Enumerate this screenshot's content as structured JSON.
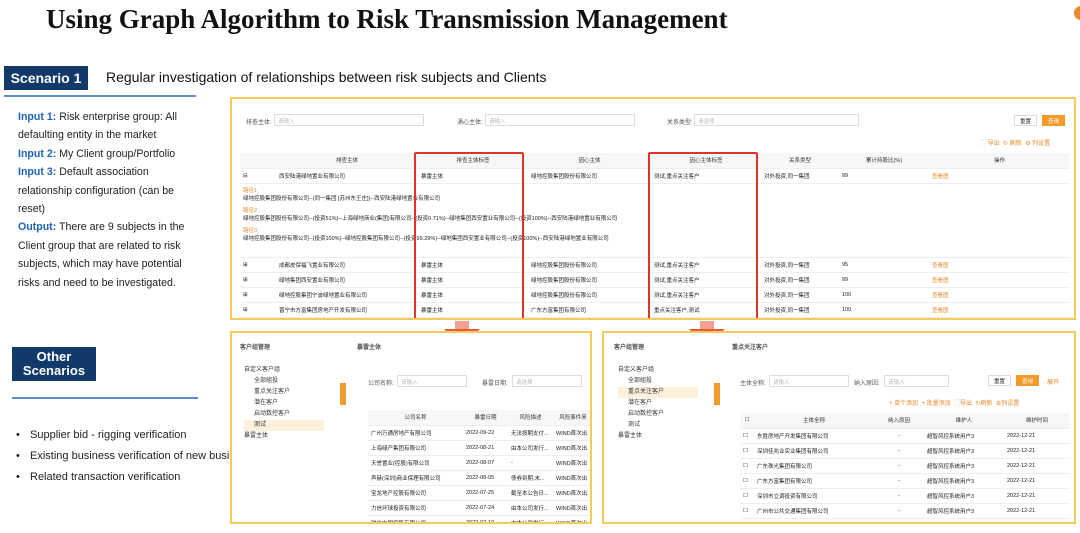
{
  "title": "Using Graph Algorithm to Risk Transmission Management",
  "scenario1": {
    "badge": "Scenario 1",
    "subtitle": "Regular investigation of relationships between risk subjects and Clients"
  },
  "description": {
    "input1_label": "Input 1:",
    "input1_text": "Risk enterprise group: All defaulting entity in the market",
    "input2_label": "Input 2:",
    "input2_text": "My Client group/Portfolio",
    "input3_label": "Input 3:",
    "input3_text": "Default association relationship configuration (can be reset)",
    "output_label": "Output:",
    "output_text": "There are 9 subjects in the Client group that are related to risk subjects, which may have potential risks and need to be investigated."
  },
  "other": {
    "badge_line1": "Other",
    "badge_line2": "Scenarios",
    "items": [
      "Supplier bid - rigging verification",
      "Existing business verification of new business subjects",
      "Related transaction verification"
    ]
  },
  "top_panel": {
    "filters": {
      "label1": "排查主体:",
      "ph1": "请输入",
      "label2": "涌心主体:",
      "ph2": "请输入",
      "label3": "关系类型:",
      "ph3": "请选择",
      "reset": "重置",
      "query": "查询"
    },
    "tools": {
      "export": "导出",
      "refresh": "刷新",
      "columns": "列设置"
    },
    "columns": [
      "排查主体",
      "排查主体标签",
      "因心主体",
      "因心主体标签",
      "关系类型",
      "累计持股比(%)",
      "操作"
    ],
    "first_row": {
      "c1": "西安陆港绿地置业有限公司",
      "c2": "暴雷主体",
      "c3": "绿地控股集团股份有限公司",
      "c4": "测试,重点关注客户",
      "c5": "对外投资,同一集团",
      "c6": "99",
      "op": "查看图"
    },
    "paths": [
      {
        "label": "路径1",
        "text": "绿地控股集团股份有限公司--(同一集团 [苏州东王庄])--西安陆港绿地置业有限公司"
      },
      {
        "label": "路径2",
        "text": "绿地控股集团股份有限公司--(投资51%)--上海绿地商业(集团)有限公司--(投资0.71%)--绿地集团西安置业有限公司--(投资100%)--西安陆港绿地置业有限公司"
      },
      {
        "label": "路径3",
        "text": "绿地控股集团股份有限公司--(投资100%)--绿地控股集团有限公司--(投资99.29%)--绿地集团西安置业有限公司--(投资100%)--西安陆港绿地置业有限公司"
      }
    ],
    "rows": [
      {
        "c1": "成都皮保福飞置业有限公司",
        "c2": "暴雷主体",
        "c3": "绿地控股集团股份有限公司",
        "c4": "测试,重点关注客户",
        "c5": "对外投资,同一集团",
        "c6": "95",
        "op": "查看图"
      },
      {
        "c1": "绿地集团西安置业有限公司",
        "c2": "暴雷主体",
        "c3": "绿地控股集团股份有限公司",
        "c4": "测试,重点关注客户",
        "c5": "对外投资,同一集团",
        "c6": "99",
        "op": "查看图"
      },
      {
        "c1": "绿地控股集团宁波绿地置业有限公司",
        "c2": "暴雷主体",
        "c3": "绿地控股集团股份有限公司",
        "c4": "测试,重点关注客户",
        "c5": "对外投资,同一集团",
        "c6": "100",
        "op": "查看图"
      },
      {
        "c1": "晋宁市方富集团房地产开发有限公司",
        "c2": "暴雷主体",
        "c3": "广东方富集团有限公司",
        "c4": "重点关注客户,测试",
        "c5": "对外投资,同一集团",
        "c6": "100",
        "op": "查看图"
      }
    ]
  },
  "left_panel": {
    "header": "客户组管理",
    "right_header": "暴雷主体",
    "tree": [
      "自定义客户组",
      "全部組投",
      "重点关注客户",
      "潜在客户",
      "启动数控客户",
      "测试",
      "暴雷主体"
    ],
    "filters": {
      "label1": "公司名称:",
      "ph1": "请输入",
      "label2": "暴雷日期:",
      "ph2": "请选择"
    },
    "columns": [
      "公司名称",
      "暴雷日期",
      "风险描述",
      "风险事件来"
    ],
    "rows": [
      {
        "c1": "广州万通房地产有限公司",
        "c2": "2022-09-22",
        "c3": "无法按期支付...",
        "c4": "WIND首次出"
      },
      {
        "c1": "上海绿产集团有限公司",
        "c2": "2022-08-21",
        "c3": "由本公司发行...",
        "c4": "WIND首次出"
      },
      {
        "c1": "天誉置业(控股)有限公司",
        "c2": "2022-08-07",
        "c3": "-",
        "c4": "WIND首次出"
      },
      {
        "c1": "声赫(深圳)商业保理有限公司",
        "c2": "2022-08-05",
        "c3": "债券到期,未...",
        "c4": "WIND首次出"
      },
      {
        "c1": "宝龙地产控股有限公司",
        "c2": "2022-07-25",
        "c3": "截至本公告日...",
        "c4": "WIND首次出"
      },
      {
        "c1": "力信环球投资有限公司",
        "c2": "2022-07-24",
        "c3": "由本公司发行...",
        "c4": "WIND首次出"
      },
      {
        "c1": "融信中国控股有限公司",
        "c2": "2022-07-10",
        "c3": "由本公司发行...",
        "c4": "WIND首次出"
      }
    ]
  },
  "right_panel": {
    "header": "客户组管理",
    "right_header": "重点关注客户",
    "tree": [
      "自定义客户组",
      "全部組投",
      "重点关注客户",
      "潜在客户",
      "启动数控客户",
      "测试",
      "暴雷主体"
    ],
    "filters": {
      "label1": "主体全称:",
      "ph1": "请输入",
      "label2": "纳入原因:",
      "ph2": "请输入",
      "reset": "重置",
      "query": "查询",
      "expand": "展开"
    },
    "tools": {
      "add_single": "+ 单个添加",
      "add_batch": "+ 批量添加",
      "export": "导出",
      "refresh": "刷新",
      "columns": "列设置"
    },
    "columns": [
      "主体全称",
      "纳入原因",
      "维护人",
      "维护时间"
    ],
    "rows": [
      {
        "c1": "东胜房地产开发集团有限公司",
        "c2": "-",
        "c3": "超智风控系统用户3",
        "c4": "2022-12-21"
      },
      {
        "c1": "深圳佳兆业实业集团有限公司",
        "c2": "-",
        "c3": "超智风控系统用户3",
        "c4": "2022-12-21"
      },
      {
        "c1": "广东珠光集团有限公司",
        "c2": "-",
        "c3": "超智风控系统用户3",
        "c4": "2022-12-21"
      },
      {
        "c1": "广东方富集团有限公司",
        "c2": "-",
        "c3": "超智风控系统用户3",
        "c4": "2022-12-21"
      },
      {
        "c1": "深圳市立调投资有限公司",
        "c2": "-",
        "c3": "超智风控系统用户3",
        "c4": "2022-12-21"
      },
      {
        "c1": "广州市公共交通集团有限公司",
        "c2": "-",
        "c3": "超智风控系统用户3",
        "c4": "2022-12-21"
      }
    ]
  },
  "colors": {
    "accent": "#f29b2b",
    "panel_border": "#f5cc5a",
    "highlight": "#e0312b",
    "badge": "#113a6a",
    "label_blue": "#1f64b4"
  }
}
